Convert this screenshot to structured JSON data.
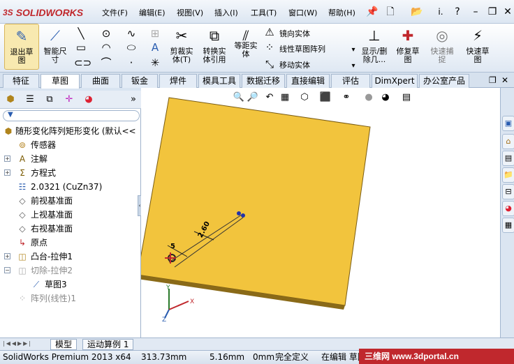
{
  "app": {
    "logo_text": "SOLIDWORKS",
    "logo_mark": "3S",
    "brand_color": "#c0282d"
  },
  "menu": [
    "文件(F)",
    "编辑(E)",
    "视图(V)",
    "插入(I)",
    "工具(T)",
    "窗口(W)",
    "帮助(H)"
  ],
  "quick_access": [
    "pin-icon",
    "new-document-icon",
    "open-folder-icon",
    "i.",
    "help-icon",
    "minimize-icon",
    "restore-icon",
    "close-icon"
  ],
  "command_manager": {
    "exit_sketch": "退出草\n图",
    "smart_dimension": "智能尺\n寸",
    "trim": "剪裁实\n体(T)",
    "convert": "转换实\n体引用",
    "offset": "等距实\n体",
    "mirror": "镜向实体",
    "linear_pattern": "线性草图阵列",
    "move": "移动实体",
    "show_delete": "显示/删\n除几...",
    "repair": "修复草\n图",
    "quick_snap": "快速捕\n捉",
    "rapid_sketch": "快速草\n图"
  },
  "tabs": [
    "特征",
    "草图",
    "曲面",
    "钣金",
    "焊件",
    "模具工具",
    "数据迁移",
    "直接编辑",
    "评估",
    "DimXpert",
    "办公室产品"
  ],
  "active_tab": "草图",
  "feature_tree": {
    "root": "随形变化阵列矩形变化  (默认<<",
    "items": [
      {
        "label": "传感器",
        "icon": "sensor-icon",
        "expand": false,
        "gray": false
      },
      {
        "label": "注解",
        "icon": "annotation-icon",
        "expand": true,
        "gray": false
      },
      {
        "label": "方程式",
        "icon": "equation-icon",
        "expand": true,
        "gray": false
      },
      {
        "label": "2.0321 (CuZn37)",
        "icon": "material-icon",
        "expand": false,
        "gray": false
      },
      {
        "label": "前视基准面",
        "icon": "plane-icon",
        "expand": false,
        "gray": false
      },
      {
        "label": "上视基准面",
        "icon": "plane-icon",
        "expand": false,
        "gray": false
      },
      {
        "label": "右视基准面",
        "icon": "plane-icon",
        "expand": false,
        "gray": false
      },
      {
        "label": "原点",
        "icon": "origin-icon",
        "expand": false,
        "gray": false
      },
      {
        "label": "凸台-拉伸1",
        "icon": "boss-extrude-icon",
        "expand": true,
        "gray": false
      },
      {
        "label": "切除-拉伸2",
        "icon": "cut-extrude-icon",
        "expand": true,
        "gray": true
      },
      {
        "label": "草图3",
        "icon": "sketch-icon",
        "expand": false,
        "gray": false
      },
      {
        "label": "阵列(线性)1",
        "icon": "linear-pattern-icon",
        "expand": false,
        "gray": true
      }
    ]
  },
  "viewport": {
    "part_color": "#f2c43d",
    "dim_1": "2.60",
    "dim_2": "5",
    "axis_x": "X",
    "axis_y": "Y",
    "axis_z": "Z"
  },
  "bottom_tabs": [
    "模型",
    "运动算例 1"
  ],
  "status": {
    "product": "SolidWorks Premium 2013 x64",
    "x": "313.73mm",
    "y": "5.16mm",
    "z": "0mm",
    "state": "完全定义",
    "editing": "在编辑 草图",
    "watermark": "三维网 www.3dportal.cn"
  }
}
